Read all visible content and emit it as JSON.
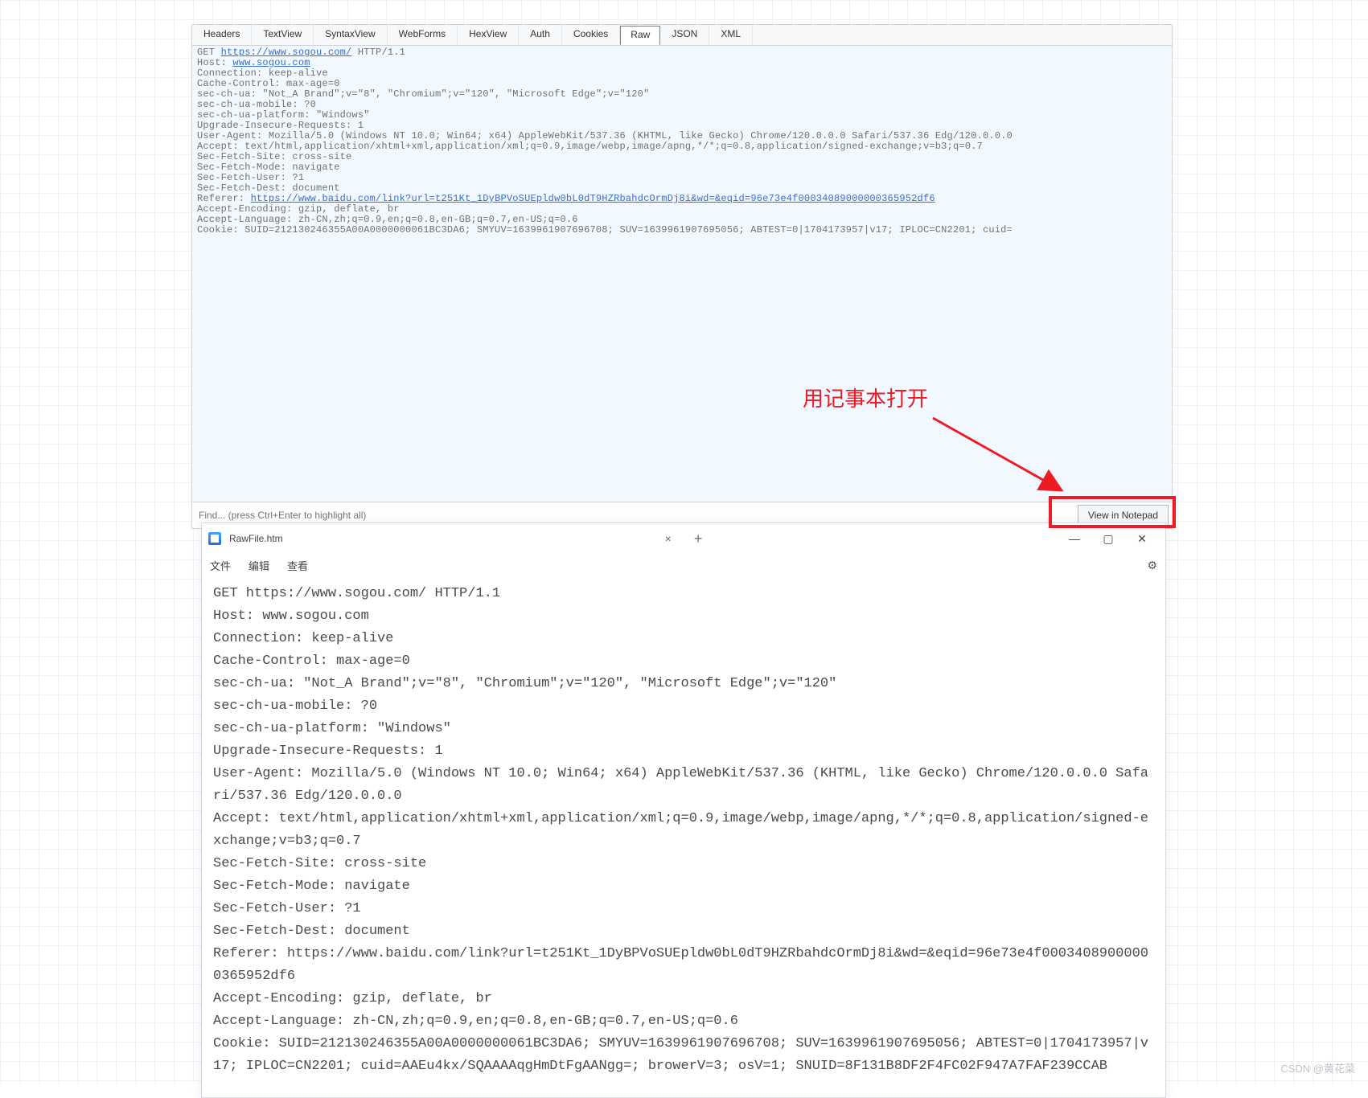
{
  "tabs": {
    "headers": "Headers",
    "textview": "TextView",
    "syntaxview": "SyntaxView",
    "webforms": "WebForms",
    "hexview": "HexView",
    "auth": "Auth",
    "cookies": "Cookies",
    "raw": "Raw",
    "json": "JSON",
    "xml": "XML"
  },
  "raw": {
    "pre": "GET ",
    "url": "https://www.sogou.com/",
    "post": " HTTP/1.1",
    "host_label": "Host: ",
    "host_link": "www.sogou.com",
    "l3": "Connection: keep-alive",
    "l4": "Cache-Control: max-age=0",
    "l5": "sec-ch-ua: \"Not_A Brand\";v=\"8\", \"Chromium\";v=\"120\", \"Microsoft Edge\";v=\"120\"",
    "l6": "sec-ch-ua-mobile: ?0",
    "l7": "sec-ch-ua-platform: \"Windows\"",
    "l8": "Upgrade-Insecure-Requests: 1",
    "l9": "User-Agent: Mozilla/5.0 (Windows NT 10.0; Win64; x64) AppleWebKit/537.36 (KHTML, like Gecko) Chrome/120.0.0.0 Safari/537.36 Edg/120.0.0.0",
    "l10": "Accept: text/html,application/xhtml+xml,application/xml;q=0.9,image/webp,image/apng,*/*;q=0.8,application/signed-exchange;v=b3;q=0.7",
    "l11": "Sec-Fetch-Site: cross-site",
    "l12": "Sec-Fetch-Mode: navigate",
    "l13": "Sec-Fetch-User: ?1",
    "l14": "Sec-Fetch-Dest: document",
    "ref_label": "Referer: ",
    "ref_link": "https://www.baidu.com/link?url=t251Kt_1DyBPVoSUEpldw0bL0dT9HZRbahdcOrmDj8i&wd=&eqid=96e73e4f00034089000000365952df6",
    "l16": "Accept-Encoding: gzip, deflate, br",
    "l17": "Accept-Language: zh-CN,zh;q=0.9,en;q=0.8,en-GB;q=0.7,en-US;q=0.6",
    "l18": "Cookie: SUID=212130246355A00A0000000061BC3DA6; SMYUV=1639961907696708; SUV=1639961907695056; ABTEST=0|1704173957|v17; IPLOC=CN2201; cuid="
  },
  "findbar": {
    "placeholder": "Find... (press Ctrl+Enter to highlight all)",
    "view_notepad": "View in Notepad"
  },
  "annotation": {
    "text": "用记事本打开"
  },
  "notepad": {
    "title": "RawFile.htm",
    "close_tab": "×",
    "add_tab": "+",
    "min": "—",
    "max": "▢",
    "close": "✕",
    "menu_file": "文件",
    "menu_edit": "编辑",
    "menu_view": "查看",
    "gear": "⚙",
    "body": "GET https://www.sogou.com/ HTTP/1.1\nHost: www.sogou.com\nConnection: keep-alive\nCache-Control: max-age=0\nsec-ch-ua: \"Not_A Brand\";v=\"8\", \"Chromium\";v=\"120\", \"Microsoft Edge\";v=\"120\"\nsec-ch-ua-mobile: ?0\nsec-ch-ua-platform: \"Windows\"\nUpgrade-Insecure-Requests: 1\nUser-Agent: Mozilla/5.0 (Windows NT 10.0; Win64; x64) AppleWebKit/537.36 (KHTML, like Gecko) Chrome/120.0.0.0 Safari/537.36 Edg/120.0.0.0\nAccept: text/html,application/xhtml+xml,application/xml;q=0.9,image/webp,image/apng,*/*;q=0.8,application/signed-exchange;v=b3;q=0.7\nSec-Fetch-Site: cross-site\nSec-Fetch-Mode: navigate\nSec-Fetch-User: ?1\nSec-Fetch-Dest: document\nReferer: https://www.baidu.com/link?url=t251Kt_1DyBPVoSUEpldw0bL0dT9HZRbahdcOrmDj8i&wd=&eqid=96e73e4f00034089000000365952df6\nAccept-Encoding: gzip, deflate, br\nAccept-Language: zh-CN,zh;q=0.9,en;q=0.8,en-GB;q=0.7,en-US;q=0.6\nCookie: SUID=212130246355A00A0000000061BC3DA6; SMYUV=1639961907696708; SUV=1639961907695056; ABTEST=0|1704173957|v17; IPLOC=CN2201; cuid=AAEu4kx/SQAAAAqgHmDtFgAANgg=; browerV=3; osV=1; SNUID=8F131B8DF2F4FC02F947A7FAF239CCAB"
  },
  "watermark": "CSDN @黄花菜"
}
